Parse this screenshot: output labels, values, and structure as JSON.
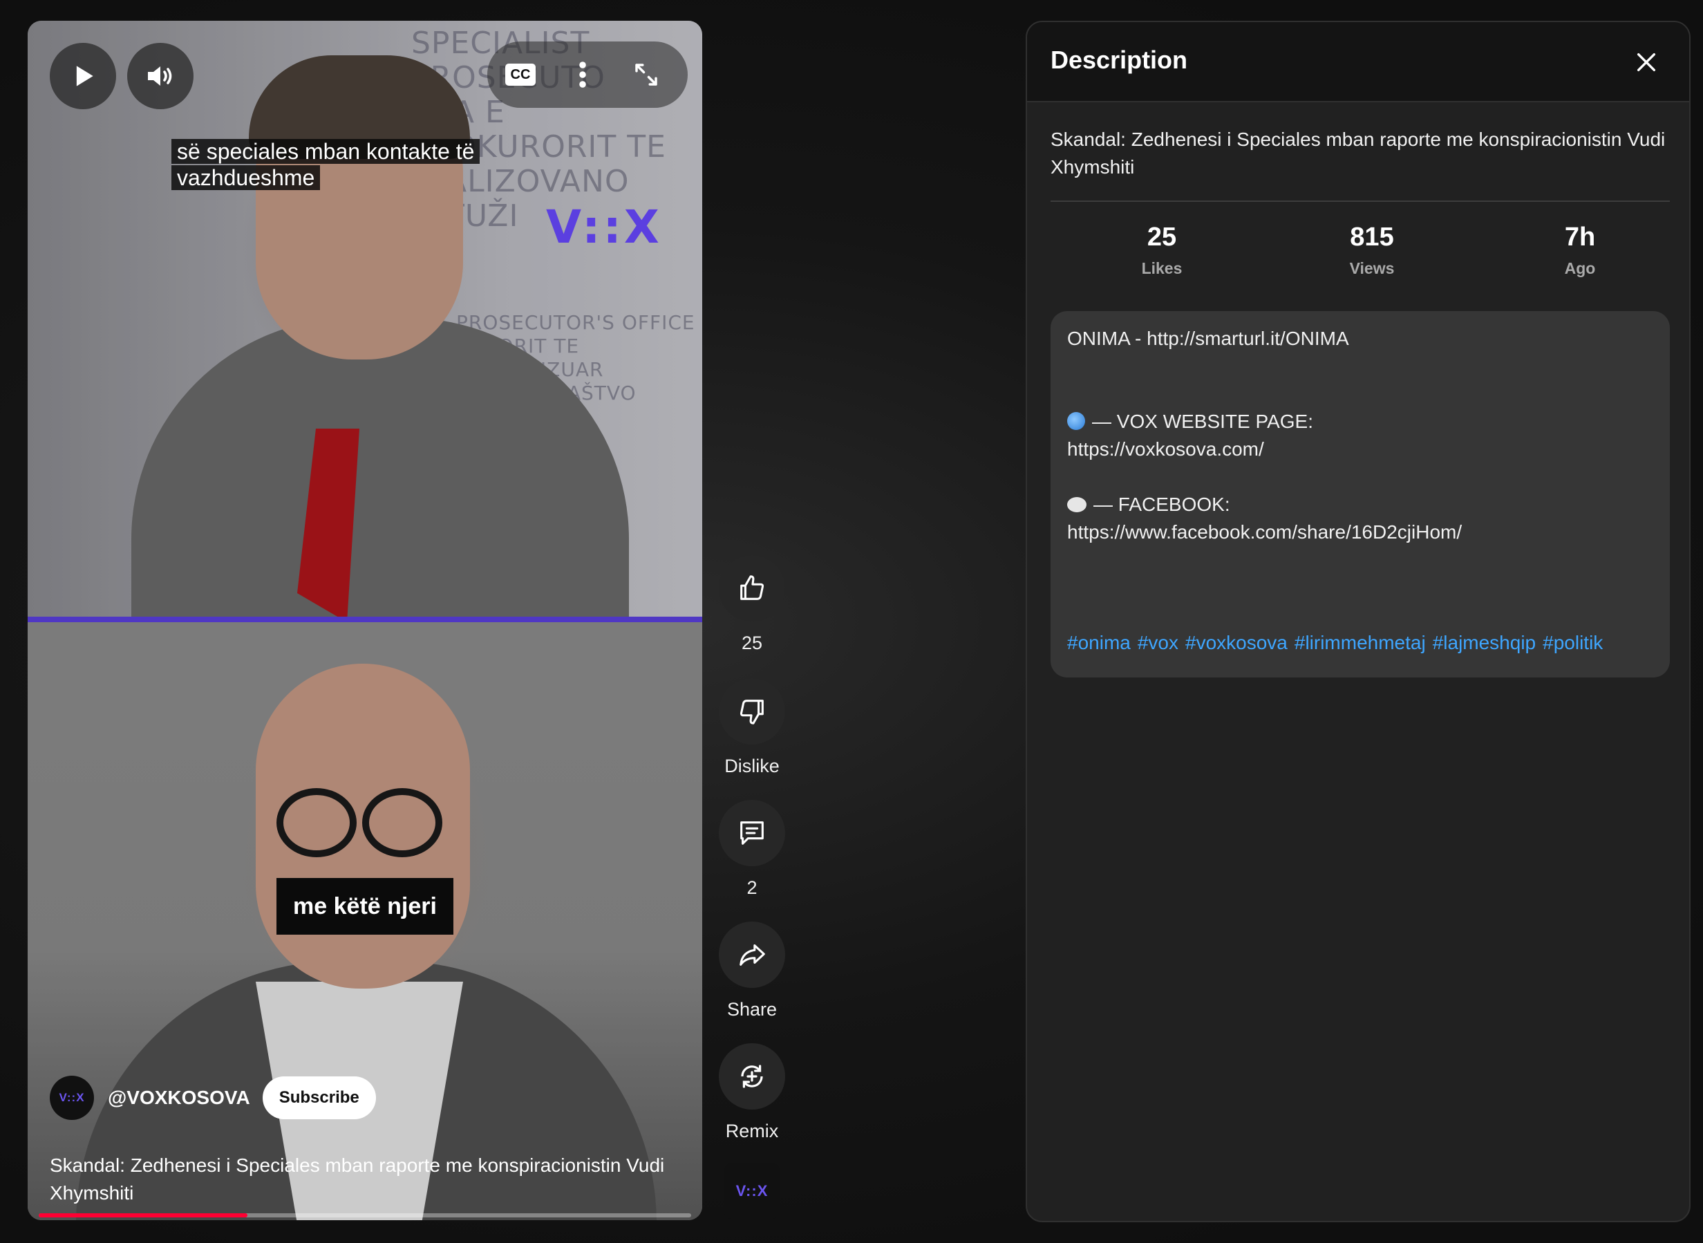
{
  "video": {
    "caption_lines": [
      "së speciales mban kontakte të",
      "vazhdueshme"
    ],
    "logo_text": "V::X",
    "burned_caption": "me këtë njeri",
    "wall_text_top": [
      "SPECIALIST PROSECUTO",
      "VRA E PROKURORIT TE",
      "ALIZOVANO TUŽI"
    ],
    "wall_text_mid": [
      "PROSECUTOR'S OFFICE",
      "KURORIT TE SPECIALIZUAR",
      "ANO TUŽILAŠTVO"
    ],
    "channel": {
      "avatar_text": "V::X",
      "name": "@VOXKOSOVA",
      "subscribe_label": "Subscribe"
    },
    "title": "Skandal: Zedhenesi i Speciales mban raporte me konspiracionistin Vudi Xhymshiti",
    "progress_fraction": 0.32,
    "controls": {
      "play_icon": "play-icon",
      "volume_icon": "volume-icon",
      "cc_label": "CC",
      "more_icon": "more-vert-icon",
      "fullscreen_icon": "fullscreen-icon"
    }
  },
  "rail": {
    "like": {
      "icon": "thumbs-up-icon",
      "label": "25"
    },
    "dislike": {
      "icon": "thumbs-down-icon",
      "label": "Dislike"
    },
    "comments": {
      "icon": "comment-icon",
      "label": "2"
    },
    "share": {
      "icon": "share-icon",
      "label": "Share"
    },
    "remix": {
      "icon": "remix-icon",
      "label": "Remix"
    },
    "sound_avatar_text": "V::X"
  },
  "panel": {
    "title": "Description",
    "video_title": "Skandal: Zedhenesi i Speciales mban raporte me konspiracionistin Vudi Xhymshiti",
    "stats": [
      {
        "value": "25",
        "label": "Likes"
      },
      {
        "value": "815",
        "label": "Views"
      },
      {
        "value": "7h",
        "label": "Ago"
      }
    ],
    "description": {
      "line1": "ONIMA - http://smarturl.it/ONIMA",
      "website_label": "— VOX WEBSITE PAGE:",
      "website_url": "https://voxkosova.com/",
      "facebook_label": "— FACEBOOK:",
      "facebook_url": "https://www.facebook.com/share/16D2cjiHom/",
      "hashtags": [
        "#onima",
        "#vox",
        "#voxkosova",
        "#lirimmehmetaj",
        "#lajmeshqip",
        "#politik"
      ]
    }
  },
  "colors": {
    "accent_purple": "#5b3fe0",
    "progress_red": "#ff0033",
    "hashtag_blue": "#3ea6ff"
  }
}
